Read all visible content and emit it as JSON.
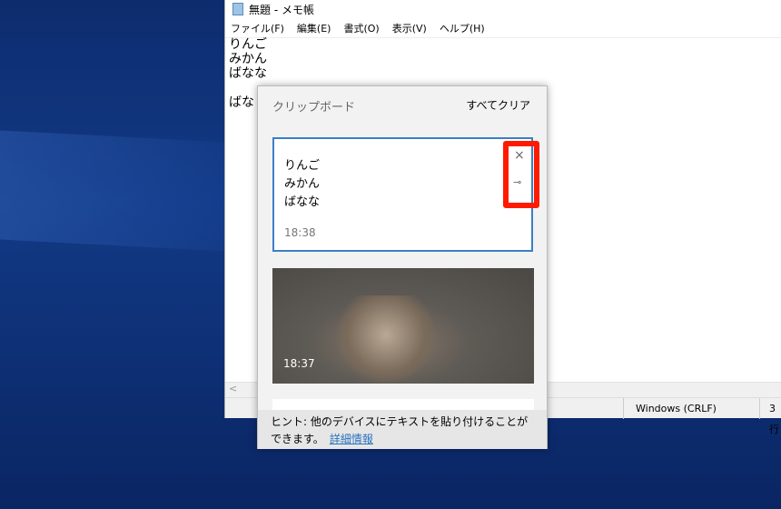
{
  "notepad": {
    "title": "無題 - メモ帳",
    "menu": [
      "ファイル(F)",
      "編集(E)",
      "書式(O)",
      "表示(V)",
      "ヘルプ(H)"
    ],
    "content": "りんご\nみかん\nばなな\n\nばな",
    "scroll_left": "<",
    "encoding": "Windows (CRLF)",
    "position": "3 行"
  },
  "clipboard": {
    "title": "クリップボード",
    "clear_all": "すべてクリア",
    "items": [
      {
        "text": "りんご\nみかん\nばなな",
        "time": "18:38",
        "delete_icon": "×",
        "pin_icon": "⊸"
      },
      {
        "type": "image",
        "time": "18:37"
      }
    ],
    "hint": "ヒント: 他のデバイスにテキストを貼り付けることができます。",
    "hint_link": "詳細情報"
  },
  "colors": {
    "selection_border": "#3a80c6",
    "highlight": "#ff1a00"
  }
}
